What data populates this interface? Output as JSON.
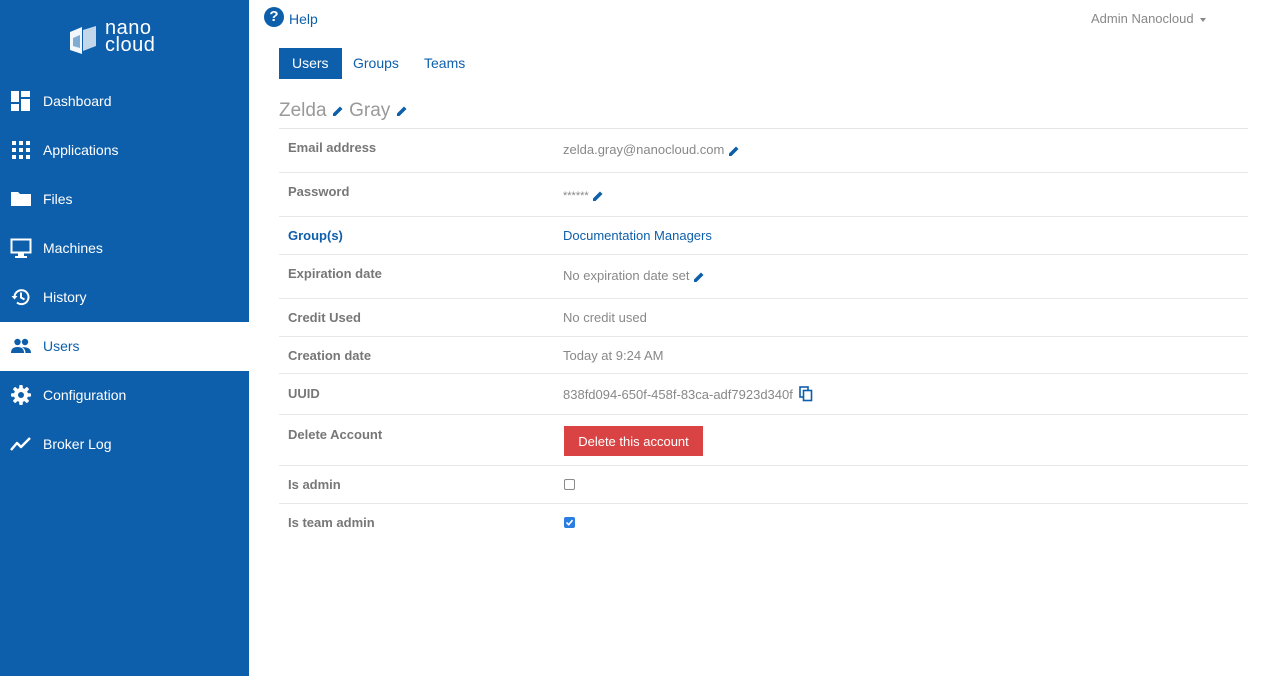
{
  "brand": {
    "line1": "nano",
    "line2": "cloud"
  },
  "sidebar": {
    "items": [
      {
        "label": "Dashboard",
        "icon": "dashboard-icon"
      },
      {
        "label": "Applications",
        "icon": "apps-grid-icon"
      },
      {
        "label": "Files",
        "icon": "folder-icon"
      },
      {
        "label": "Machines",
        "icon": "monitor-icon"
      },
      {
        "label": "History",
        "icon": "history-icon"
      },
      {
        "label": "Users",
        "icon": "users-icon",
        "active": true
      },
      {
        "label": "Configuration",
        "icon": "gear-icon"
      },
      {
        "label": "Broker Log",
        "icon": "line-chart-icon"
      }
    ]
  },
  "header": {
    "help_label": "Help",
    "help_icon": "?",
    "user_menu": "Admin Nanocloud"
  },
  "tabs": [
    {
      "label": "Users",
      "active": true
    },
    {
      "label": "Groups"
    },
    {
      "label": "Teams"
    }
  ],
  "user": {
    "first_name": "Zelda",
    "last_name": "Gray"
  },
  "details": {
    "email": {
      "label": "Email address",
      "value": "zelda.gray@nanocloud.com"
    },
    "password": {
      "label": "Password",
      "value": "******"
    },
    "groups": {
      "label": "Group(s)",
      "value": "Documentation Managers"
    },
    "expiration": {
      "label": "Expiration date",
      "value": "No expiration date set"
    },
    "credit": {
      "label": "Credit Used",
      "value": "No credit used"
    },
    "creation": {
      "label": "Creation date",
      "value": "Today at 9:24 AM"
    },
    "uuid": {
      "label": "UUID",
      "value": "838fd094-650f-458f-83ca-adf7923d340f"
    },
    "delete": {
      "label": "Delete Account",
      "button": "Delete this account"
    },
    "is_admin": {
      "label": "Is admin",
      "checked": false
    },
    "is_team_admin": {
      "label": "Is team admin",
      "checked": true
    }
  },
  "colors": {
    "primary": "#0e5fab",
    "danger": "#d94343",
    "checkbox": "#2a7de1"
  }
}
